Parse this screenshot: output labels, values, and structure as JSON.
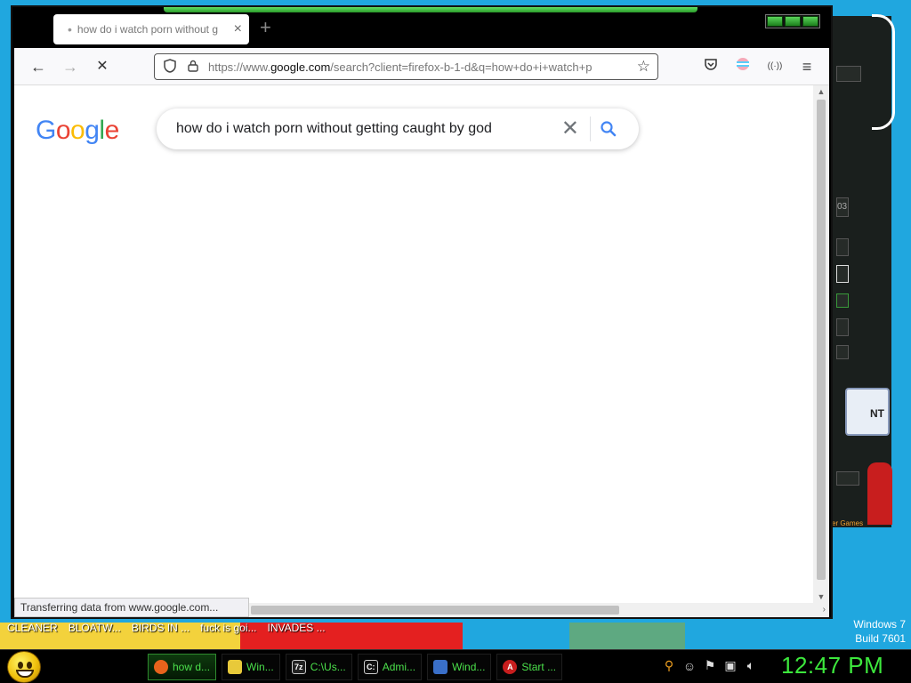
{
  "browser": {
    "tab": {
      "title": "how do i watch porn without g"
    },
    "address": {
      "prefix": "https://www.",
      "domain": "google.com",
      "rest": "/search?client=firefox-b-1-d&q=how+do+i+watch+p"
    },
    "status": "Transferring data from www.google.com..."
  },
  "google": {
    "logo_letters": [
      "G",
      "o",
      "o",
      "g",
      "l",
      "e"
    ],
    "logo_colors": [
      "#4285F4",
      "#EA4335",
      "#FBBC05",
      "#4285F4",
      "#34A853",
      "#EA4335"
    ],
    "query": "how do i watch porn without getting caught by god"
  },
  "desktop": {
    "labels": [
      "CLEANER",
      "BLOATW...",
      "BIRDS IN ...",
      "fuck is goi...",
      "INVADES ..."
    ],
    "os_name": "Windows 7",
    "os_build": "Build 7601",
    "background_app": {
      "tag": "NT",
      "footer": "er Games",
      "counter": "03"
    }
  },
  "taskbar": {
    "items": [
      {
        "label": "how d...",
        "icon": "firefox-icon",
        "color": "#e8631c"
      },
      {
        "label": "Win...",
        "icon": "folder-icon",
        "color": "#e8c93a"
      },
      {
        "label": "C:\\Us...",
        "icon": "7zip-icon",
        "color": "#222222"
      },
      {
        "label": "Admi...",
        "icon": "cmd-icon",
        "color": "#111111"
      },
      {
        "label": "Wind...",
        "icon": "windows-update-icon",
        "color": "#3a6fc8"
      },
      {
        "label": "Start ...",
        "icon": "anarchy-icon",
        "color": "#c81e1e"
      }
    ],
    "clock": "12:47 PM"
  }
}
